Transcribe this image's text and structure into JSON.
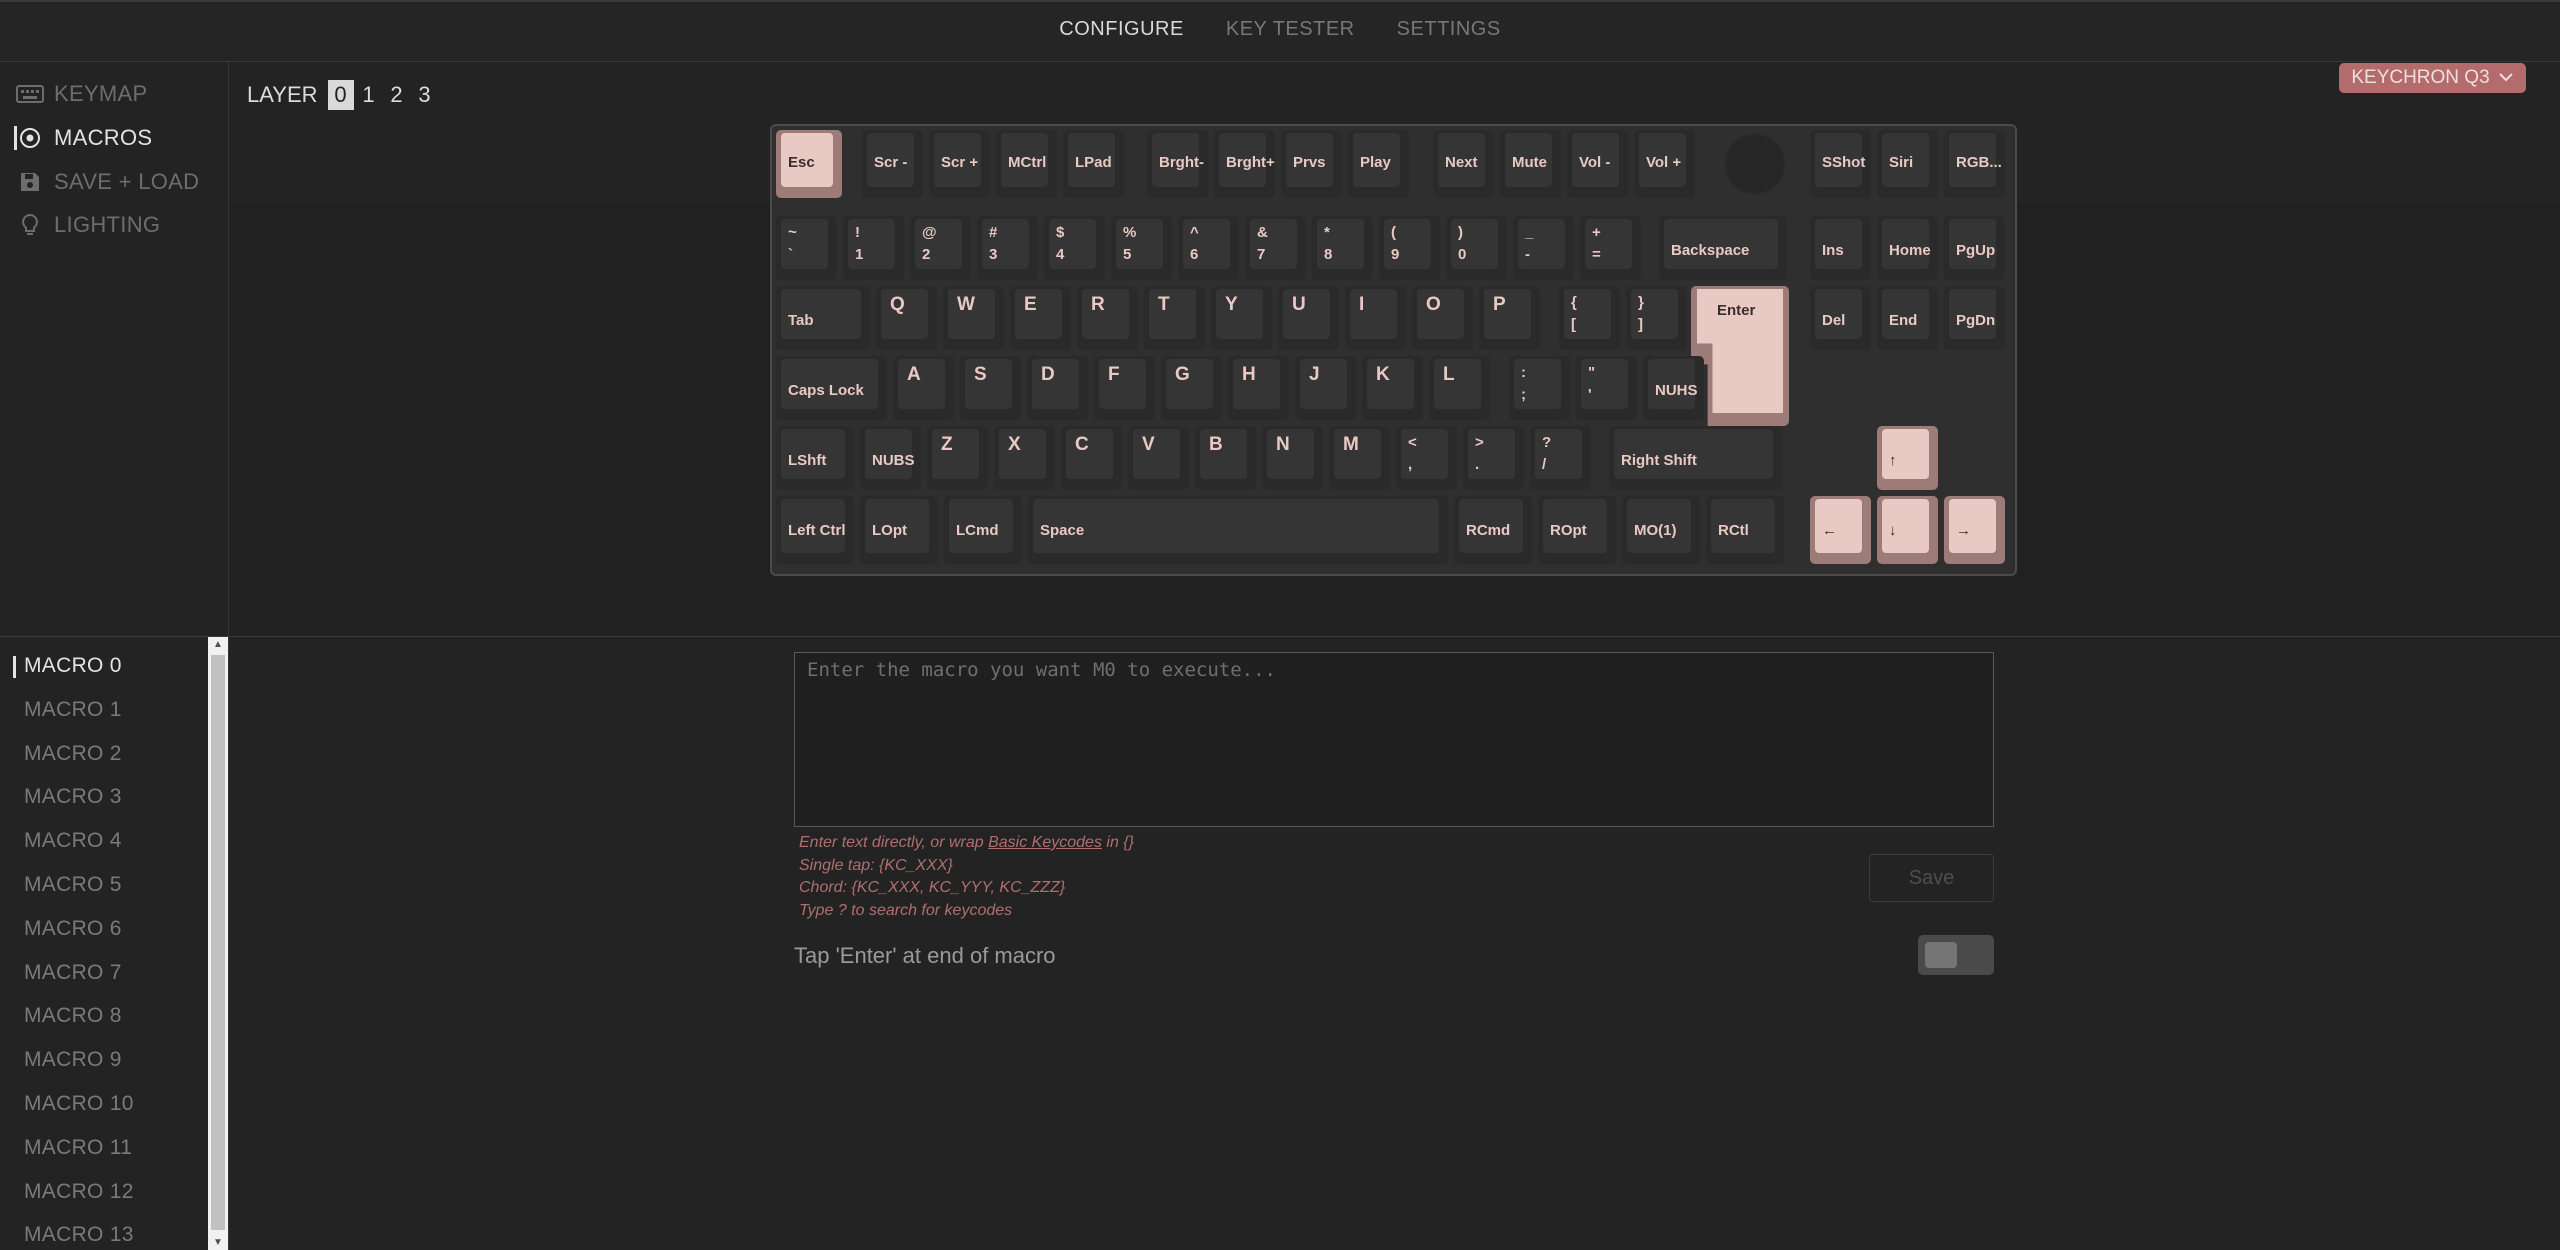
{
  "topnav": {
    "configure": "CONFIGURE",
    "key_tester": "KEY TESTER",
    "settings": "SETTINGS"
  },
  "sidebar": {
    "items": [
      {
        "label": "KEYMAP",
        "icon": "keyboard-icon"
      },
      {
        "label": "MACROS",
        "icon": "record-icon"
      },
      {
        "label": "SAVE + LOAD",
        "icon": "floppy-icon"
      },
      {
        "label": "LIGHTING",
        "icon": "bulb-icon"
      }
    ]
  },
  "layer": {
    "label": "LAYER",
    "numbers": [
      "0",
      "1",
      "2",
      "3"
    ],
    "selected": "0"
  },
  "keyboard_select": "KEYCHRON Q3",
  "keys": {
    "r0": [
      "Esc",
      "Scr -",
      "Scr +",
      "MCtrl",
      "LPad",
      "Brght-",
      "Brght+",
      "Prvs",
      "Play",
      "Next",
      "Mute",
      "Vol -",
      "Vol +",
      "SShot",
      "Siri",
      "RGB..."
    ],
    "r1": [
      [
        "~",
        "`"
      ],
      [
        "!",
        "1"
      ],
      [
        "@",
        "2"
      ],
      [
        "#",
        "3"
      ],
      [
        "$",
        "4"
      ],
      [
        "%",
        "5"
      ],
      [
        "^",
        "6"
      ],
      [
        "&",
        "7"
      ],
      [
        "*",
        "8"
      ],
      [
        "(",
        "9"
      ],
      [
        ")",
        "0"
      ],
      [
        "_",
        "-"
      ],
      [
        "+",
        "="
      ],
      "Backspace",
      "Ins",
      "Home",
      "PgUp"
    ],
    "r2": [
      "Tab",
      "Q",
      "W",
      "E",
      "R",
      "T",
      "Y",
      "U",
      "I",
      "O",
      "P",
      [
        "{",
        "["
      ],
      [
        "}",
        "]"
      ],
      "Enter",
      "Del",
      "End",
      "PgDn"
    ],
    "r3": [
      "Caps Lock",
      "A",
      "S",
      "D",
      "F",
      "G",
      "H",
      "J",
      "K",
      "L",
      [
        ":",
        ";"
      ],
      [
        "\"",
        "'"
      ],
      "NUHS"
    ],
    "r4": [
      "LShft",
      "NUBS",
      "Z",
      "X",
      "C",
      "V",
      "B",
      "N",
      "M",
      [
        "<",
        ","
      ],
      [
        ">",
        "."
      ],
      [
        "?",
        "/"
      ],
      "Right Shift",
      "↑"
    ],
    "r5": [
      "Left Ctrl",
      "LOpt",
      "LCmd",
      "Space",
      "RCmd",
      "ROpt",
      "MO(1)",
      "RCtl",
      "←",
      "↓",
      "→"
    ]
  },
  "macros": [
    "MACRO 0",
    "MACRO 1",
    "MACRO 2",
    "MACRO 3",
    "MACRO 4",
    "MACRO 5",
    "MACRO 6",
    "MACRO 7",
    "MACRO 8",
    "MACRO 9",
    "MACRO 10",
    "MACRO 11",
    "MACRO 12",
    "MACRO 13"
  ],
  "editor": {
    "placeholder": "Enter the macro you want M0 to execute...",
    "hint1_pre": "Enter text directly, or wrap ",
    "hint1_link": "Basic Keycodes",
    "hint1_post": " in {}",
    "hint2": "Single tap: {KC_XXX}",
    "hint3": "Chord: {KC_XXX, KC_YYY, KC_ZZZ}",
    "hint4": "Type ? to search for keycodes",
    "save": "Save",
    "enter_label": "Tap 'Enter' at end of macro",
    "enter_toggle": false
  },
  "colors": {
    "accent_key": "#e9c9c3",
    "selector": "#b36b6b",
    "hint": "#b06f6f"
  }
}
